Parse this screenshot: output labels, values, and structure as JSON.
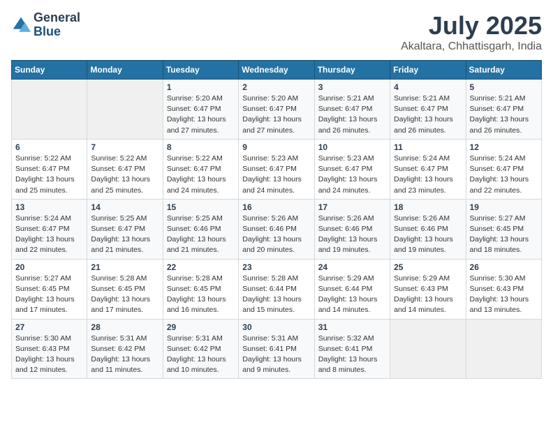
{
  "logo": {
    "line1": "General",
    "line2": "Blue"
  },
  "title": "July 2025",
  "subtitle": "Akaltara, Chhattisgarh, India",
  "weekdays": [
    "Sunday",
    "Monday",
    "Tuesday",
    "Wednesday",
    "Thursday",
    "Friday",
    "Saturday"
  ],
  "weeks": [
    [
      {
        "day": "",
        "sunrise": "",
        "sunset": "",
        "daylight": ""
      },
      {
        "day": "",
        "sunrise": "",
        "sunset": "",
        "daylight": ""
      },
      {
        "day": "1",
        "sunrise": "Sunrise: 5:20 AM",
        "sunset": "Sunset: 6:47 PM",
        "daylight": "Daylight: 13 hours and 27 minutes."
      },
      {
        "day": "2",
        "sunrise": "Sunrise: 5:20 AM",
        "sunset": "Sunset: 6:47 PM",
        "daylight": "Daylight: 13 hours and 27 minutes."
      },
      {
        "day": "3",
        "sunrise": "Sunrise: 5:21 AM",
        "sunset": "Sunset: 6:47 PM",
        "daylight": "Daylight: 13 hours and 26 minutes."
      },
      {
        "day": "4",
        "sunrise": "Sunrise: 5:21 AM",
        "sunset": "Sunset: 6:47 PM",
        "daylight": "Daylight: 13 hours and 26 minutes."
      },
      {
        "day": "5",
        "sunrise": "Sunrise: 5:21 AM",
        "sunset": "Sunset: 6:47 PM",
        "daylight": "Daylight: 13 hours and 26 minutes."
      }
    ],
    [
      {
        "day": "6",
        "sunrise": "Sunrise: 5:22 AM",
        "sunset": "Sunset: 6:47 PM",
        "daylight": "Daylight: 13 hours and 25 minutes."
      },
      {
        "day": "7",
        "sunrise": "Sunrise: 5:22 AM",
        "sunset": "Sunset: 6:47 PM",
        "daylight": "Daylight: 13 hours and 25 minutes."
      },
      {
        "day": "8",
        "sunrise": "Sunrise: 5:22 AM",
        "sunset": "Sunset: 6:47 PM",
        "daylight": "Daylight: 13 hours and 24 minutes."
      },
      {
        "day": "9",
        "sunrise": "Sunrise: 5:23 AM",
        "sunset": "Sunset: 6:47 PM",
        "daylight": "Daylight: 13 hours and 24 minutes."
      },
      {
        "day": "10",
        "sunrise": "Sunrise: 5:23 AM",
        "sunset": "Sunset: 6:47 PM",
        "daylight": "Daylight: 13 hours and 24 minutes."
      },
      {
        "day": "11",
        "sunrise": "Sunrise: 5:24 AM",
        "sunset": "Sunset: 6:47 PM",
        "daylight": "Daylight: 13 hours and 23 minutes."
      },
      {
        "day": "12",
        "sunrise": "Sunrise: 5:24 AM",
        "sunset": "Sunset: 6:47 PM",
        "daylight": "Daylight: 13 hours and 22 minutes."
      }
    ],
    [
      {
        "day": "13",
        "sunrise": "Sunrise: 5:24 AM",
        "sunset": "Sunset: 6:47 PM",
        "daylight": "Daylight: 13 hours and 22 minutes."
      },
      {
        "day": "14",
        "sunrise": "Sunrise: 5:25 AM",
        "sunset": "Sunset: 6:47 PM",
        "daylight": "Daylight: 13 hours and 21 minutes."
      },
      {
        "day": "15",
        "sunrise": "Sunrise: 5:25 AM",
        "sunset": "Sunset: 6:46 PM",
        "daylight": "Daylight: 13 hours and 21 minutes."
      },
      {
        "day": "16",
        "sunrise": "Sunrise: 5:26 AM",
        "sunset": "Sunset: 6:46 PM",
        "daylight": "Daylight: 13 hours and 20 minutes."
      },
      {
        "day": "17",
        "sunrise": "Sunrise: 5:26 AM",
        "sunset": "Sunset: 6:46 PM",
        "daylight": "Daylight: 13 hours and 19 minutes."
      },
      {
        "day": "18",
        "sunrise": "Sunrise: 5:26 AM",
        "sunset": "Sunset: 6:46 PM",
        "daylight": "Daylight: 13 hours and 19 minutes."
      },
      {
        "day": "19",
        "sunrise": "Sunrise: 5:27 AM",
        "sunset": "Sunset: 6:45 PM",
        "daylight": "Daylight: 13 hours and 18 minutes."
      }
    ],
    [
      {
        "day": "20",
        "sunrise": "Sunrise: 5:27 AM",
        "sunset": "Sunset: 6:45 PM",
        "daylight": "Daylight: 13 hours and 17 minutes."
      },
      {
        "day": "21",
        "sunrise": "Sunrise: 5:28 AM",
        "sunset": "Sunset: 6:45 PM",
        "daylight": "Daylight: 13 hours and 17 minutes."
      },
      {
        "day": "22",
        "sunrise": "Sunrise: 5:28 AM",
        "sunset": "Sunset: 6:45 PM",
        "daylight": "Daylight: 13 hours and 16 minutes."
      },
      {
        "day": "23",
        "sunrise": "Sunrise: 5:28 AM",
        "sunset": "Sunset: 6:44 PM",
        "daylight": "Daylight: 13 hours and 15 minutes."
      },
      {
        "day": "24",
        "sunrise": "Sunrise: 5:29 AM",
        "sunset": "Sunset: 6:44 PM",
        "daylight": "Daylight: 13 hours and 14 minutes."
      },
      {
        "day": "25",
        "sunrise": "Sunrise: 5:29 AM",
        "sunset": "Sunset: 6:43 PM",
        "daylight": "Daylight: 13 hours and 14 minutes."
      },
      {
        "day": "26",
        "sunrise": "Sunrise: 5:30 AM",
        "sunset": "Sunset: 6:43 PM",
        "daylight": "Daylight: 13 hours and 13 minutes."
      }
    ],
    [
      {
        "day": "27",
        "sunrise": "Sunrise: 5:30 AM",
        "sunset": "Sunset: 6:43 PM",
        "daylight": "Daylight: 13 hours and 12 minutes."
      },
      {
        "day": "28",
        "sunrise": "Sunrise: 5:31 AM",
        "sunset": "Sunset: 6:42 PM",
        "daylight": "Daylight: 13 hours and 11 minutes."
      },
      {
        "day": "29",
        "sunrise": "Sunrise: 5:31 AM",
        "sunset": "Sunset: 6:42 PM",
        "daylight": "Daylight: 13 hours and 10 minutes."
      },
      {
        "day": "30",
        "sunrise": "Sunrise: 5:31 AM",
        "sunset": "Sunset: 6:41 PM",
        "daylight": "Daylight: 13 hours and 9 minutes."
      },
      {
        "day": "31",
        "sunrise": "Sunrise: 5:32 AM",
        "sunset": "Sunset: 6:41 PM",
        "daylight": "Daylight: 13 hours and 8 minutes."
      },
      {
        "day": "",
        "sunrise": "",
        "sunset": "",
        "daylight": ""
      },
      {
        "day": "",
        "sunrise": "",
        "sunset": "",
        "daylight": ""
      }
    ]
  ]
}
